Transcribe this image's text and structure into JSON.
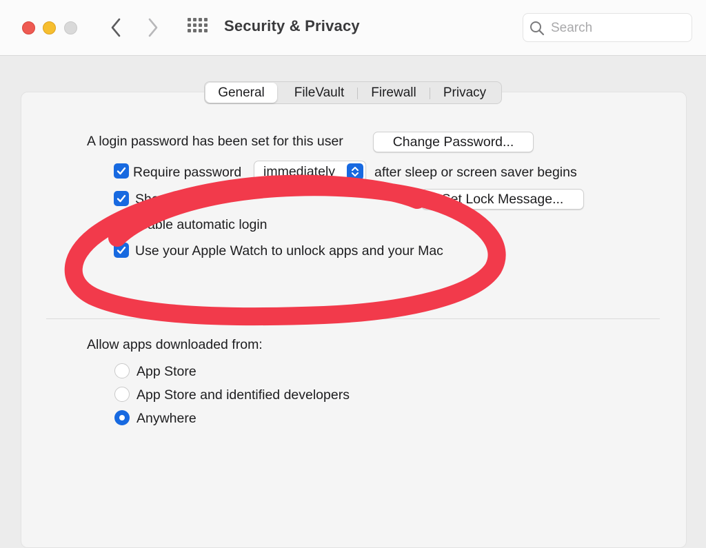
{
  "window": {
    "title": "Security & Privacy",
    "traffic_lights": {
      "close": "#ee5a52",
      "minimize": "#f6be2f",
      "zoom": "#d9d9d9"
    }
  },
  "toolbar": {
    "back_icon": "chevron-left-icon",
    "forward_icon": "chevron-right-icon",
    "show_all_icon": "grid-icon",
    "search": {
      "placeholder": "Search",
      "value": "",
      "icon": "search-icon"
    }
  },
  "tabs": [
    {
      "label": "General",
      "selected": true
    },
    {
      "label": "FileVault",
      "selected": false
    },
    {
      "label": "Firewall",
      "selected": false
    },
    {
      "label": "Privacy",
      "selected": false
    }
  ],
  "general": {
    "login_text": "A login password has been set for this user",
    "change_password_label": "Change Password...",
    "require_password": {
      "label": "Require password",
      "checked": true,
      "selected_option": "immediately",
      "suffix": "after sleep or screen saver begins"
    },
    "show_message": {
      "label_visible": "Show a m",
      "checked": true
    },
    "set_lock_message_label": "Set Lock Message...",
    "disable_auto_login": {
      "label_visible": "isable automatic login",
      "checked": true
    },
    "apple_watch": {
      "label": "Use your Apple Watch to unlock apps and your Mac",
      "checked": true
    }
  },
  "downloads": {
    "heading": "Allow apps downloaded from:",
    "options": [
      {
        "label": "App Store",
        "selected": false
      },
      {
        "label": "App Store and identified developers",
        "selected": false
      },
      {
        "label": "Anywhere",
        "selected": true
      }
    ]
  },
  "annotation": {
    "shape": "hand-drawn-ellipse",
    "color": "#f23a4b"
  },
  "colors": {
    "accent": "#1769e0",
    "background": "#ececec",
    "panel": "#f5f5f5"
  }
}
